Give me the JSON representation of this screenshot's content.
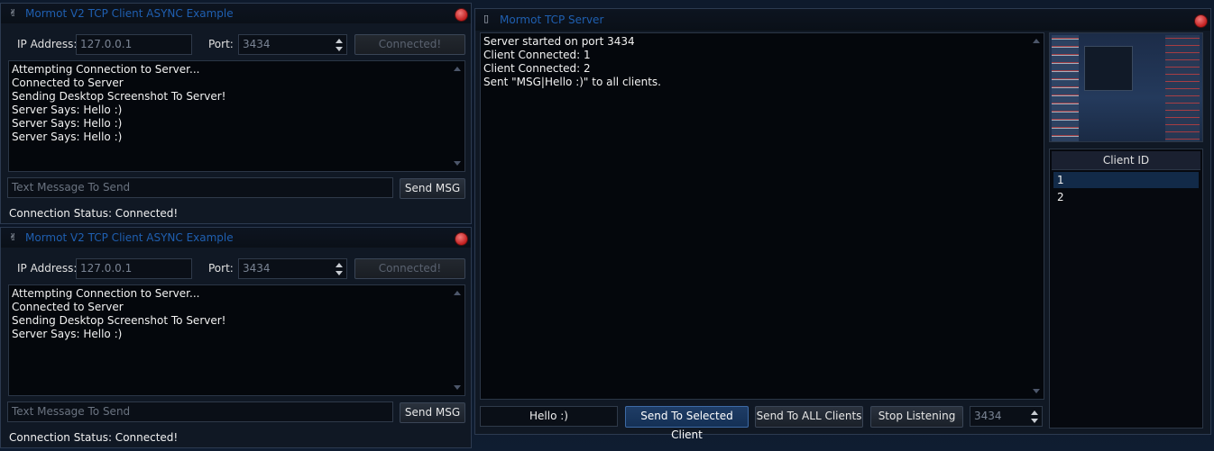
{
  "client1": {
    "title": "Mormot V2 TCP Client ASYNC Example",
    "ip_label": "IP Address:",
    "ip_value": "127.0.0.1",
    "port_label": "Port:",
    "port_value": "3434",
    "connect_button": "Connected!",
    "log": [
      "Attempting Connection to Server...",
      "Connected to Server",
      "Sending Desktop Screenshot To Server!",
      "Server Says: Hello :)",
      "Server Says: Hello :)",
      "Server Says: Hello :)"
    ],
    "message_placeholder": "Text Message To Send",
    "send_button": "Send MSG",
    "status": "Connection Status: Connected!"
  },
  "client2": {
    "title": "Mormot V2 TCP Client ASYNC Example",
    "ip_label": "IP Address:",
    "ip_value": "127.0.0.1",
    "port_label": "Port:",
    "port_value": "3434",
    "connect_button": "Connected!",
    "log": [
      "Attempting Connection to Server...",
      "Connected to Server",
      "Sending Desktop Screenshot To Server!",
      "Server Says: Hello :)"
    ],
    "message_placeholder": "Text Message To Send",
    "send_button": "Send MSG",
    "status": "Connection Status: Connected!"
  },
  "server": {
    "title": "Mormot TCP Server",
    "log": [
      "Server started on port 3434",
      "Client Connected: 1",
      "Client Connected: 2",
      "Sent \"MSG|Hello :)\" to all clients."
    ],
    "clients_header": "Client ID",
    "clients": [
      "1",
      "2"
    ],
    "selected_client": "1",
    "message_value": "Hello :)",
    "send_selected_button": "Send To Selected Client",
    "send_all_button": "Send To ALL Clients",
    "stop_button": "Stop Listening",
    "port_value": "3434"
  },
  "colors": {
    "title_text": "#1f5fb0",
    "close_button": "#c21e1e",
    "selected_row": "#122a48",
    "window_bg": "#101824"
  },
  "icons": {
    "client_window_icon": "plug-icon",
    "server_window_icon": "phone-icon",
    "close_icon": "close-icon"
  }
}
